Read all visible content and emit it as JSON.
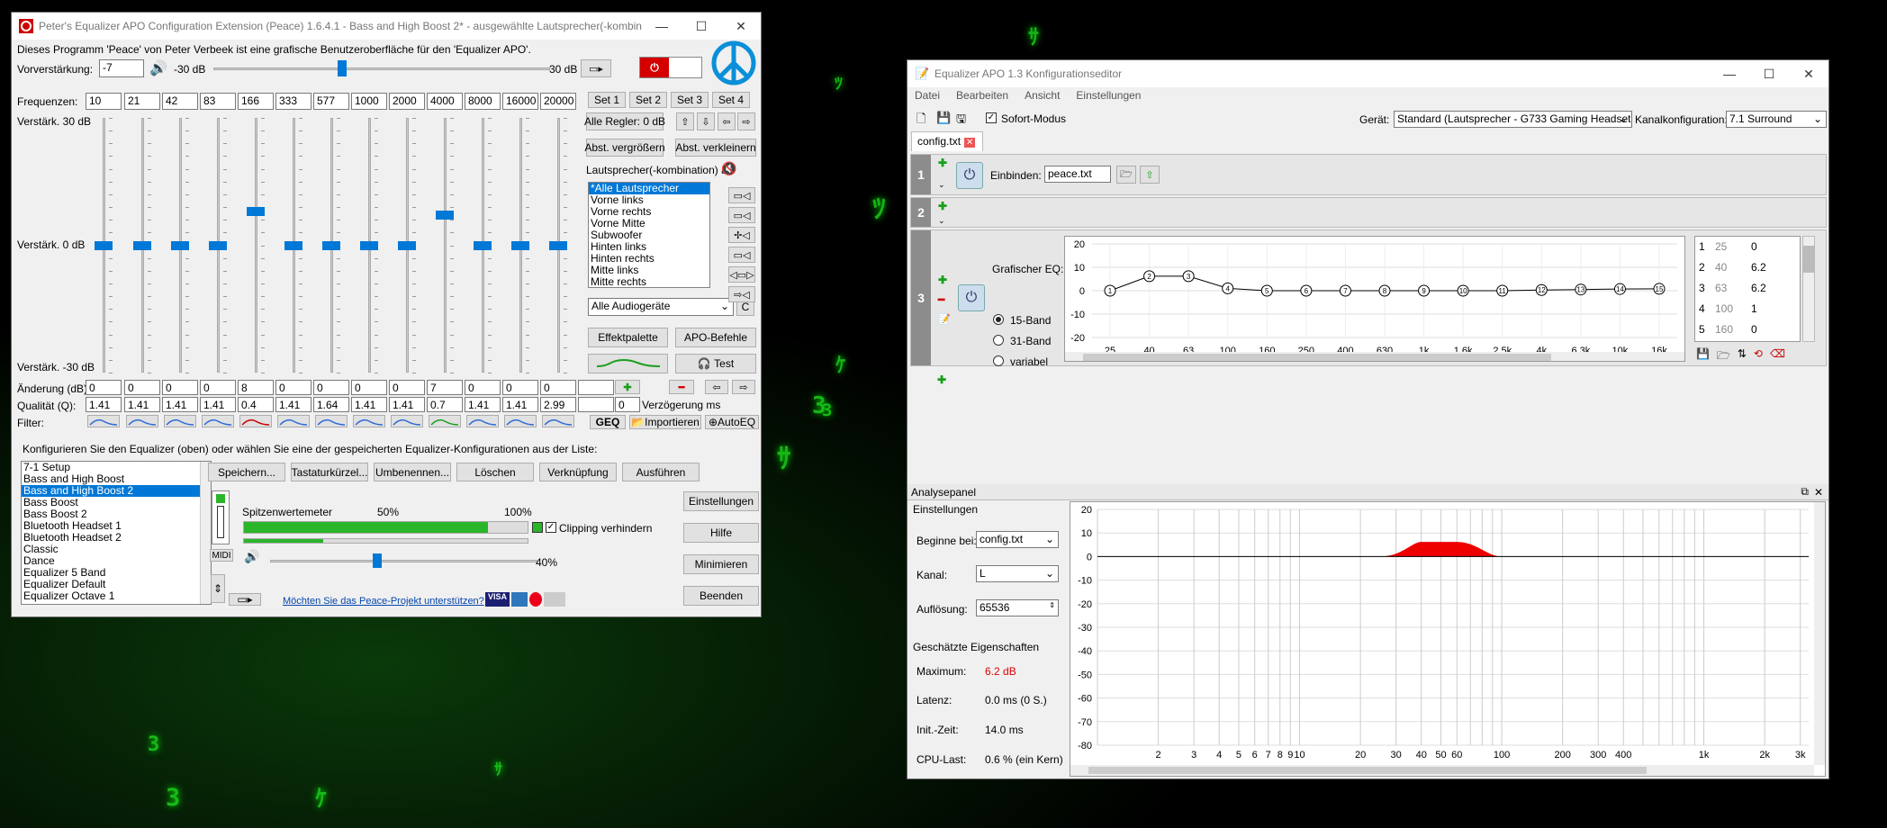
{
  "peace": {
    "title": "Peter's Equalizer APO Configuration Extension (Peace) 1.6.4.1 - Bass and High Boost 2* - ausgewählte Lautsprecher(-kombina...",
    "intro": "Dieses Programm 'Peace' von Peter Verbeek ist eine grafische Benutzeroberfläche für den 'Equalizer APO'.",
    "preamp_label": "Vorverstärkung:",
    "preamp_value": "-7",
    "preamp_min": "-30 dB",
    "preamp_max": "30 dB",
    "preamp_level_db": -7,
    "freq_label": "Frequenzen:",
    "freqs": [
      "10",
      "21",
      "42",
      "83",
      "166",
      "333",
      "577",
      "1000",
      "2000",
      "4000",
      "8000",
      "16000",
      "20000"
    ],
    "sets": [
      "Set 1",
      "Set 2",
      "Set 3",
      "Set 4"
    ],
    "gain_top": "Verstärk. 30 dB",
    "gain_mid": "Verstärk. 0 dB",
    "gain_bot": "Verstärk. -30 dB",
    "gain_values_db": [
      0,
      0,
      0,
      0,
      8,
      0,
      0,
      0,
      0,
      7,
      0,
      0,
      0
    ],
    "change_label": "Änderung (dB):",
    "changes": [
      "0",
      "0",
      "0",
      "0",
      "8",
      "0",
      "0",
      "0",
      "0",
      "7",
      "0",
      "0",
      "0",
      ""
    ],
    "q_label": "Qualität (Q):",
    "qs": [
      "1.41",
      "1.41",
      "1.41",
      "1.41",
      "0.4",
      "1.41",
      "1.64",
      "1.41",
      "1.41",
      "0.7",
      "1.41",
      "1.41",
      "2.99",
      ""
    ],
    "filter_label": "Filter:",
    "delay_value": "0",
    "delay_label": "Verzögerung ms",
    "all_regler": "Alle Regler: 0 dB",
    "abst_grow": "Abst. vergrößern",
    "abst_shrink": "Abst. verkleinern",
    "speaker_label": "Lautsprecher(-kombination) au",
    "speakers": [
      "*Alle Lautsprecher",
      "Vorne links",
      "Vorne rechts",
      "Vorne Mitte",
      "Subwoofer",
      "Hinten links",
      "Hinten rechts",
      "Mitte links",
      "Mitte rechts"
    ],
    "device_select": "Alle Audiogeräte",
    "c_btn": "C",
    "effektpalette": "Effektpalette",
    "apo_befehle": "APO-Befehle",
    "test": "Test",
    "geq": "GEQ",
    "importieren": "Importieren",
    "autoeq": "AutoEQ",
    "config_text": "Konfigurieren Sie den Equalizer (oben) oder wählen Sie eine der gespeicherten Equalizer-Konfigurationen aus der Liste:",
    "configs": [
      "7-1 Setup",
      "Bass and High Boost",
      "Bass and High Boost 2",
      "Bass Boost",
      "Bass Boost 2",
      "Bluetooth Headset 1",
      "Bluetooth Headset 2",
      "Classic",
      "Dance",
      "Equalizer 5 Band",
      "Equalizer Default",
      "Equalizer Octave 1"
    ],
    "actions": [
      "Speichern...",
      "Tastaturkürzel...",
      "Umbenennen...",
      "Löschen",
      "Verknüpfung",
      "Ausführen"
    ],
    "spitzen": "Spitzenwertemeter",
    "p50": "50%",
    "p100": "100%",
    "peak_level": 0.86,
    "clipping": "Clipping verhindern",
    "volume": "40%",
    "volume_level": 0.4,
    "midi": "MIDI",
    "support_link": "Möchten Sie das Peace-Projekt unterstützen?",
    "side_buttons": [
      "Einstellungen",
      "Hilfe",
      "Minimieren",
      "Beenden"
    ]
  },
  "apo": {
    "title": "Equalizer APO 1.3 Konfigurationseditor",
    "menu": [
      "Datei",
      "Bearbeiten",
      "Ansicht",
      "Einstellungen"
    ],
    "sofort": "Sofort-Modus",
    "geraet_label": "Gerät:",
    "geraet": "Standard (Lautsprecher - G733 Gaming Headset)",
    "kanal_label": "Kanalkonfiguration:",
    "kanal": "7.1 Surround",
    "tab": "config.txt",
    "row1_num": "1",
    "row2_num": "2",
    "row3_num": "3",
    "einbinden_label": "Einbinden:",
    "einbinden_value": "peace.txt",
    "geq_label": "Grafischer EQ:",
    "band15": "15-Band",
    "band31": "31-Band",
    "variabel": "variabel",
    "geq_y": [
      "20",
      "10",
      "0",
      "-10",
      "-20"
    ],
    "geq_x": [
      "25",
      "40",
      "63",
      "100",
      "160",
      "250",
      "400",
      "630",
      "1k",
      "1.6k",
      "2.5k",
      "4k",
      "6.3k",
      "10k",
      "16k"
    ],
    "geq_points": [
      "1",
      "2",
      "3",
      "4",
      "5",
      "6",
      "7",
      "8",
      "9",
      "10",
      "11",
      "12",
      "13",
      "14",
      "15"
    ],
    "geq_values": [
      0,
      6.2,
      6.2,
      1,
      0,
      0,
      0,
      0,
      0,
      0,
      0,
      0.3,
      0.5,
      0.7,
      0.8
    ],
    "table": [
      [
        "1",
        "25",
        "0"
      ],
      [
        "2",
        "40",
        "6.2"
      ],
      [
        "3",
        "63",
        "6.2"
      ],
      [
        "4",
        "100",
        "1"
      ],
      [
        "5",
        "160",
        "0"
      ]
    ],
    "analyse": "Analysepanel",
    "einstellungen": "Einstellungen",
    "beginne_label": "Beginne bei:",
    "beginne": "config.txt",
    "kanal2_label": "Kanal:",
    "kanal2": "L",
    "aufl_label": "Auflösung:",
    "aufl": "65536",
    "eig": "Geschätzte Eigenschaften",
    "max_label": "Maximum:",
    "max": "6.2 dB",
    "lat_label": "Latenz:",
    "lat": "0.0 ms (0 S.)",
    "init_label": "Init.-Zeit:",
    "init": "14.0 ms",
    "cpu_label": "CPU-Last:",
    "cpu": "0.6 % (ein Kern)",
    "an_y": [
      "20",
      "10",
      "0",
      "-10",
      "-20",
      "-30",
      "-40",
      "-50",
      "-60",
      "-70",
      "-80"
    ],
    "an_x": [
      "2",
      "3",
      "4",
      "5",
      "6",
      "7",
      "8",
      "9",
      "10",
      "20",
      "30",
      "40",
      "50",
      "60",
      "100",
      "200",
      "300",
      "400",
      "1k",
      "2k",
      "3k"
    ]
  },
  "colors": {
    "accent": "#0078d7",
    "red": "#e00000",
    "green": "#2bb52b"
  }
}
